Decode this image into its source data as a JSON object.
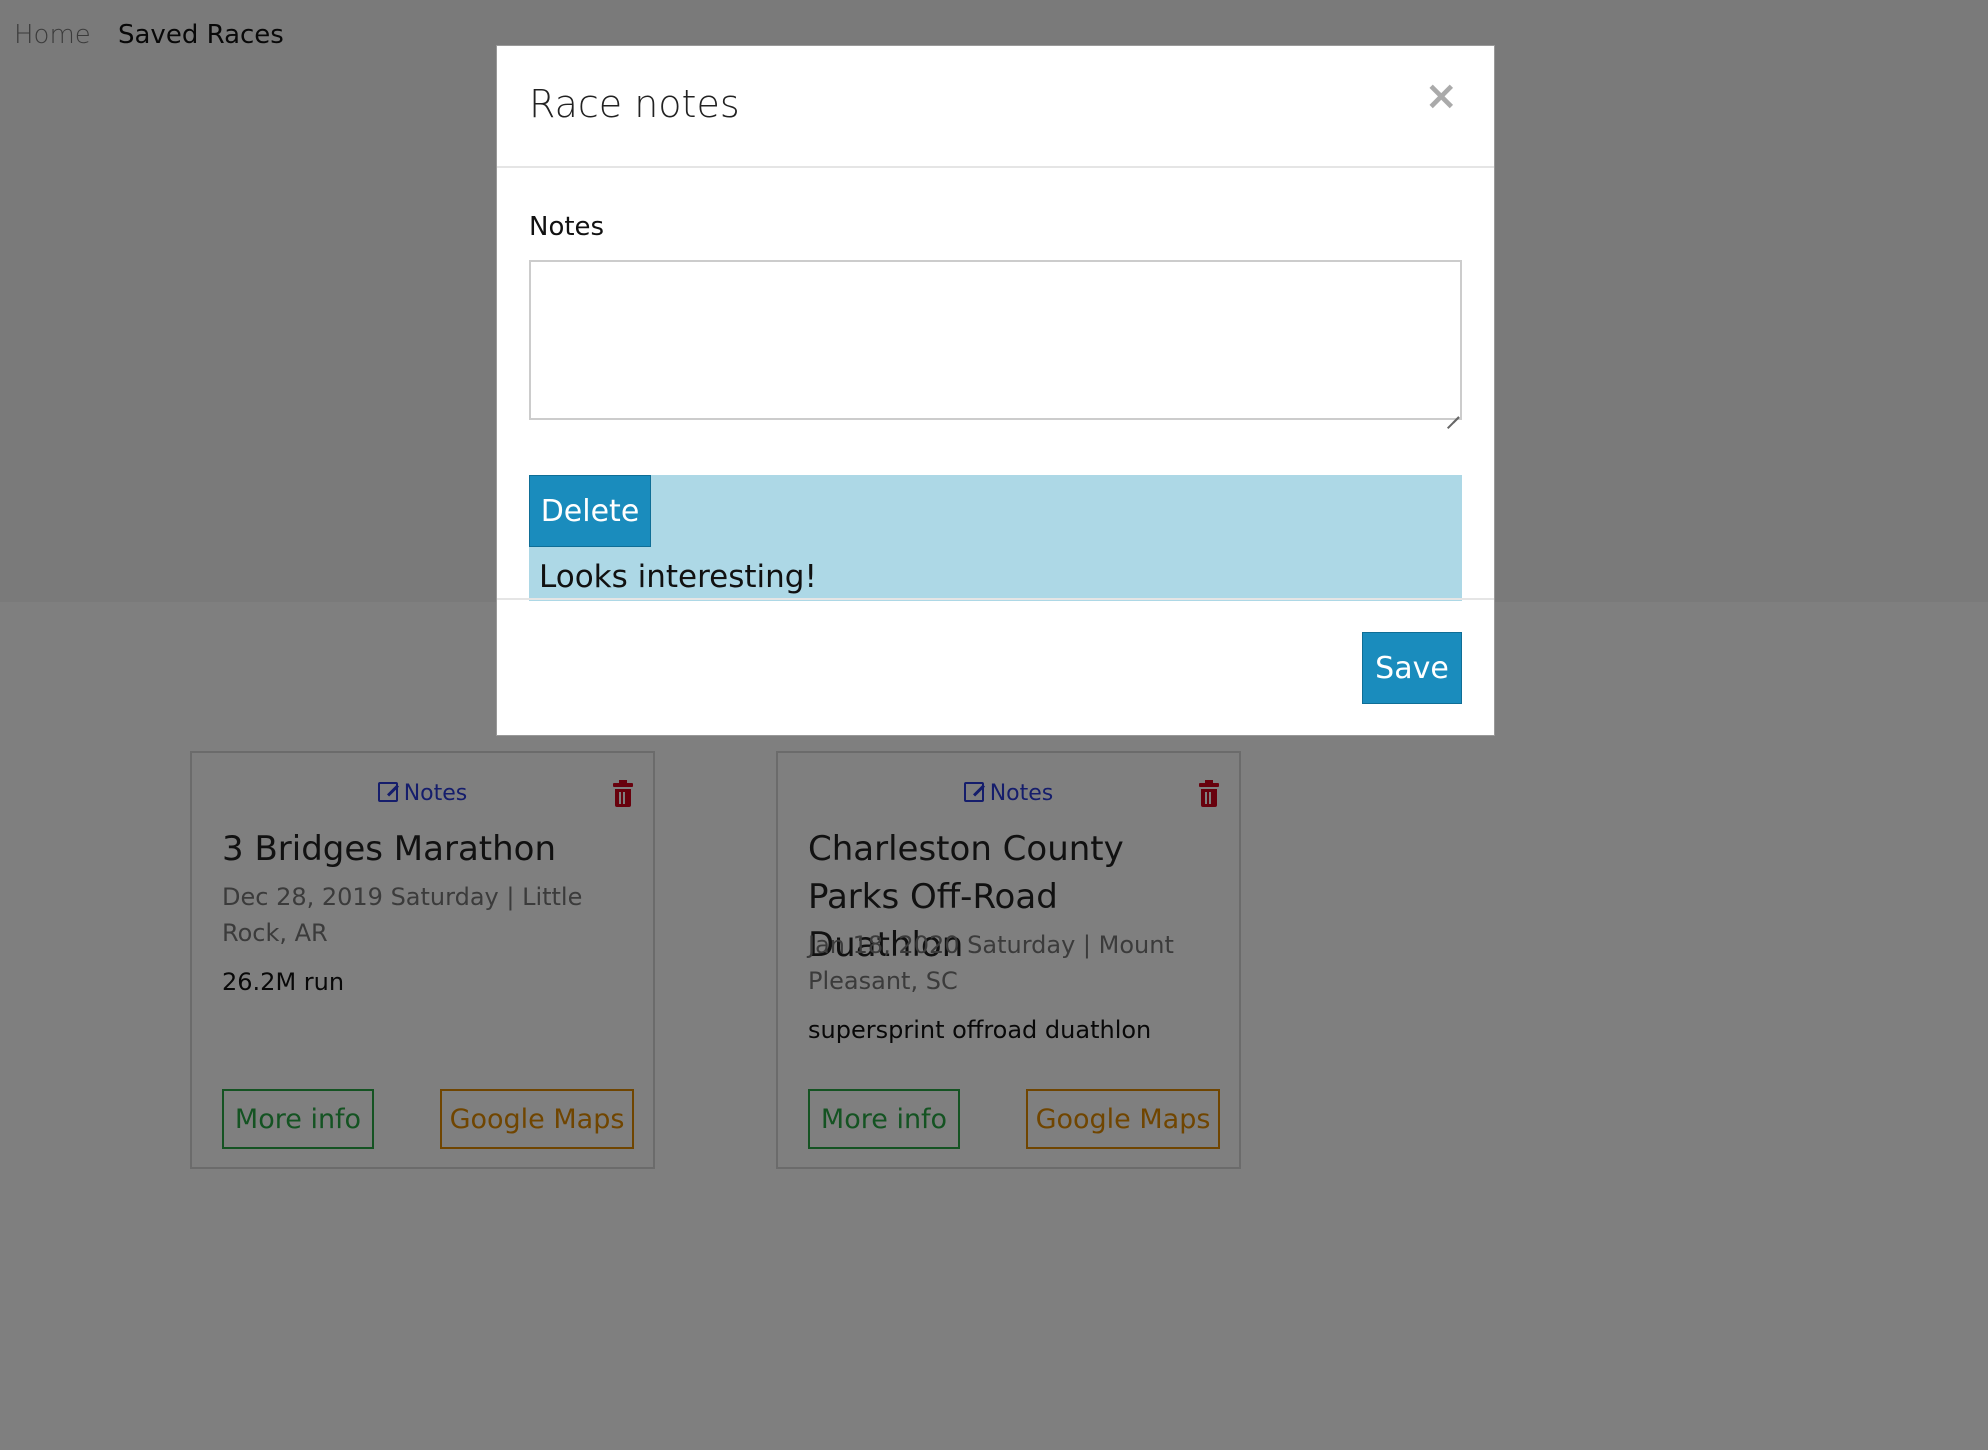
{
  "nav": {
    "home": "Home",
    "saved_races": "Saved Races"
  },
  "cards": [
    {
      "notes_link": "Notes",
      "title": "3 Bridges Marathon",
      "meta": "Dec 28, 2019 Saturday | Little Rock, AR",
      "description": "26.2M run",
      "more_info": "More info",
      "maps": "Google Maps"
    },
    {
      "notes_link": "Notes",
      "title": "Charleston County Parks Off-Road Duathlon",
      "meta": "Jan 18, 2020 Saturday | Mount Pleasant, SC",
      "description": "supersprint offroad duathlon",
      "more_info": "More info",
      "maps": "Google Maps"
    }
  ],
  "modal": {
    "title": "Race notes",
    "close_symbol": "×",
    "notes_label": "Notes",
    "textarea_value": "",
    "delete_label": "Delete",
    "saved_note": "Looks interesting!",
    "save_label": "Save"
  },
  "colors": {
    "primary": "#1a8cbd",
    "note_bg": "#add8e6",
    "more_info": "#28a745",
    "maps": "#e08a00",
    "notes_link": "#2a3ad8",
    "delete_icon": "#d0021b"
  },
  "icons": {
    "notes": "edit-icon",
    "delete_card": "trash-icon",
    "close": "close-icon"
  }
}
